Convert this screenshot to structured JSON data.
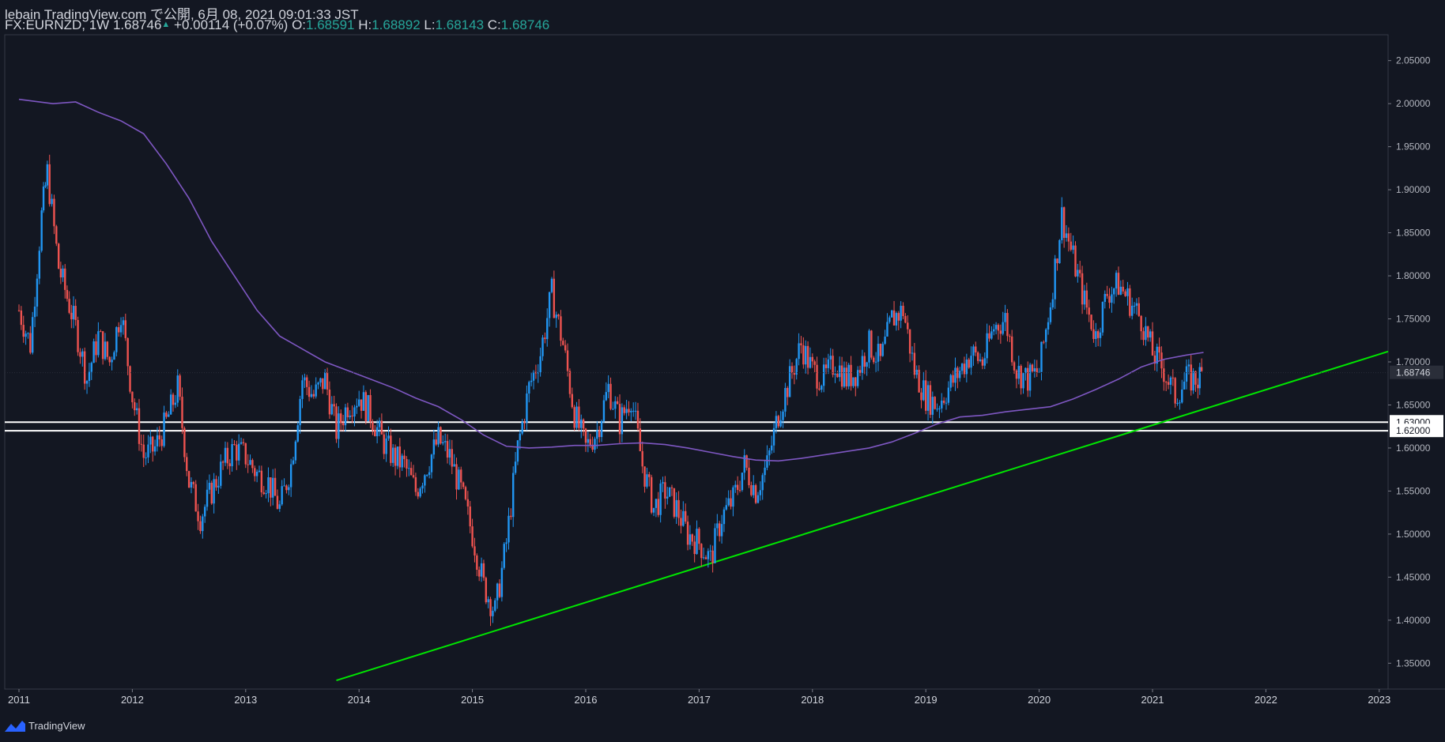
{
  "header": {
    "line1": "lebain TradingView.com で公開, 6月 08, 2021 09:01:33 JST",
    "symbol": "FX:EURNZD, 1W",
    "last": "1.68746",
    "change": "+0.00114 (+0.07%)",
    "open_label": "O:",
    "open": "1.68591",
    "high_label": "H:",
    "high": "1.68892",
    "low_label": "L:",
    "low": "1.68143",
    "close_label": "C:",
    "close": "1.68746"
  },
  "brand": "TradingView",
  "colors": {
    "background": "#131722",
    "up": "#2196f3",
    "down": "#ef5350",
    "ma": "#7e57c2",
    "trendline": "#00e600",
    "hline": "#ffffff",
    "text": "#d1d4dc"
  },
  "chart_data": {
    "type": "candlestick",
    "symbol": "FX:EURNZD",
    "interval": "1W",
    "ylim": [
      1.32,
      2.08
    ],
    "y_ticks": [
      "2.05000",
      "2.00000",
      "1.95000",
      "1.90000",
      "1.85000",
      "1.80000",
      "1.75000",
      "1.70000",
      "1.65000",
      "1.60000",
      "1.55000",
      "1.50000",
      "1.45000",
      "1.40000",
      "1.35000"
    ],
    "x_ticks": [
      "2011",
      "2012",
      "2013",
      "2014",
      "2015",
      "2016",
      "2017",
      "2018",
      "2019",
      "2020",
      "2021",
      "2022",
      "2023"
    ],
    "x_start_year": 2011,
    "price_series": [
      [
        2011.0,
        1.76
      ],
      [
        2011.1,
        1.72
      ],
      [
        2011.2,
        1.87
      ],
      [
        2011.25,
        1.92
      ],
      [
        2011.35,
        1.81
      ],
      [
        2011.5,
        1.74
      ],
      [
        2011.6,
        1.68
      ],
      [
        2011.7,
        1.73
      ],
      [
        2011.8,
        1.7
      ],
      [
        2011.9,
        1.76
      ],
      [
        2012.0,
        1.66
      ],
      [
        2012.1,
        1.59
      ],
      [
        2012.2,
        1.6
      ],
      [
        2012.3,
        1.63
      ],
      [
        2012.4,
        1.67
      ],
      [
        2012.5,
        1.56
      ],
      [
        2012.6,
        1.52
      ],
      [
        2012.7,
        1.55
      ],
      [
        2012.8,
        1.58
      ],
      [
        2012.9,
        1.6
      ],
      [
        2013.0,
        1.59
      ],
      [
        2013.1,
        1.57
      ],
      [
        2013.2,
        1.56
      ],
      [
        2013.3,
        1.53
      ],
      [
        2013.4,
        1.58
      ],
      [
        2013.5,
        1.68
      ],
      [
        2013.6,
        1.66
      ],
      [
        2013.7,
        1.68
      ],
      [
        2013.8,
        1.62
      ],
      [
        2013.9,
        1.65
      ],
      [
        2014.0,
        1.66
      ],
      [
        2014.1,
        1.64
      ],
      [
        2014.2,
        1.61
      ],
      [
        2014.3,
        1.59
      ],
      [
        2014.4,
        1.58
      ],
      [
        2014.5,
        1.55
      ],
      [
        2014.6,
        1.58
      ],
      [
        2014.7,
        1.61
      ],
      [
        2014.8,
        1.59
      ],
      [
        2014.9,
        1.55
      ],
      [
        2015.0,
        1.5
      ],
      [
        2015.1,
        1.44
      ],
      [
        2015.2,
        1.41
      ],
      [
        2015.3,
        1.49
      ],
      [
        2015.4,
        1.6
      ],
      [
        2015.5,
        1.67
      ],
      [
        2015.6,
        1.71
      ],
      [
        2015.7,
        1.78
      ],
      [
        2015.8,
        1.72
      ],
      [
        2015.9,
        1.64
      ],
      [
        2016.0,
        1.6
      ],
      [
        2016.1,
        1.62
      ],
      [
        2016.2,
        1.67
      ],
      [
        2016.3,
        1.63
      ],
      [
        2016.4,
        1.66
      ],
      [
        2016.5,
        1.58
      ],
      [
        2016.6,
        1.53
      ],
      [
        2016.7,
        1.55
      ],
      [
        2016.8,
        1.53
      ],
      [
        2016.9,
        1.5
      ],
      [
        2017.0,
        1.49
      ],
      [
        2017.1,
        1.47
      ],
      [
        2017.2,
        1.52
      ],
      [
        2017.3,
        1.54
      ],
      [
        2017.4,
        1.58
      ],
      [
        2017.5,
        1.55
      ],
      [
        2017.6,
        1.58
      ],
      [
        2017.7,
        1.64
      ],
      [
        2017.8,
        1.68
      ],
      [
        2017.9,
        1.72
      ],
      [
        2018.0,
        1.69
      ],
      [
        2018.1,
        1.68
      ],
      [
        2018.2,
        1.7
      ],
      [
        2018.3,
        1.68
      ],
      [
        2018.4,
        1.69
      ],
      [
        2018.5,
        1.72
      ],
      [
        2018.6,
        1.7
      ],
      [
        2018.7,
        1.75
      ],
      [
        2018.8,
        1.76
      ],
      [
        2018.9,
        1.69
      ],
      [
        2019.0,
        1.66
      ],
      [
        2019.1,
        1.65
      ],
      [
        2019.2,
        1.67
      ],
      [
        2019.3,
        1.69
      ],
      [
        2019.4,
        1.71
      ],
      [
        2019.5,
        1.7
      ],
      [
        2019.6,
        1.74
      ],
      [
        2019.7,
        1.75
      ],
      [
        2019.8,
        1.69
      ],
      [
        2019.9,
        1.68
      ],
      [
        2020.0,
        1.69
      ],
      [
        2020.1,
        1.77
      ],
      [
        2020.2,
        1.87
      ],
      [
        2020.3,
        1.82
      ],
      [
        2020.4,
        1.77
      ],
      [
        2020.5,
        1.73
      ],
      [
        2020.6,
        1.78
      ],
      [
        2020.7,
        1.79
      ],
      [
        2020.8,
        1.77
      ],
      [
        2020.9,
        1.75
      ],
      [
        2021.0,
        1.71
      ],
      [
        2021.1,
        1.69
      ],
      [
        2021.2,
        1.66
      ],
      [
        2021.3,
        1.68
      ],
      [
        2021.4,
        1.68
      ],
      [
        2021.45,
        1.6875
      ]
    ],
    "moving_average": [
      [
        2011.0,
        2.005
      ],
      [
        2011.3,
        2.0
      ],
      [
        2011.5,
        2.002
      ],
      [
        2011.7,
        1.99
      ],
      [
        2011.9,
        1.98
      ],
      [
        2012.1,
        1.965
      ],
      [
        2012.3,
        1.93
      ],
      [
        2012.5,
        1.89
      ],
      [
        2012.7,
        1.84
      ],
      [
        2012.9,
        1.8
      ],
      [
        2013.1,
        1.76
      ],
      [
        2013.3,
        1.73
      ],
      [
        2013.5,
        1.715
      ],
      [
        2013.7,
        1.7
      ],
      [
        2013.9,
        1.69
      ],
      [
        2014.1,
        1.68
      ],
      [
        2014.3,
        1.67
      ],
      [
        2014.5,
        1.658
      ],
      [
        2014.7,
        1.648
      ],
      [
        2014.9,
        1.633
      ],
      [
        2015.1,
        1.615
      ],
      [
        2015.3,
        1.602
      ],
      [
        2015.5,
        1.6
      ],
      [
        2015.7,
        1.601
      ],
      [
        2015.9,
        1.603
      ],
      [
        2016.1,
        1.603
      ],
      [
        2016.3,
        1.605
      ],
      [
        2016.5,
        1.606
      ],
      [
        2016.7,
        1.604
      ],
      [
        2016.9,
        1.6
      ],
      [
        2017.1,
        1.595
      ],
      [
        2017.3,
        1.59
      ],
      [
        2017.5,
        1.586
      ],
      [
        2017.7,
        1.585
      ],
      [
        2017.9,
        1.588
      ],
      [
        2018.1,
        1.592
      ],
      [
        2018.3,
        1.596
      ],
      [
        2018.5,
        1.6
      ],
      [
        2018.7,
        1.607
      ],
      [
        2018.9,
        1.617
      ],
      [
        2019.1,
        1.628
      ],
      [
        2019.3,
        1.636
      ],
      [
        2019.5,
        1.638
      ],
      [
        2019.7,
        1.642
      ],
      [
        2019.9,
        1.645
      ],
      [
        2020.1,
        1.648
      ],
      [
        2020.3,
        1.657
      ],
      [
        2020.5,
        1.668
      ],
      [
        2020.7,
        1.68
      ],
      [
        2020.9,
        1.694
      ],
      [
        2021.1,
        1.703
      ],
      [
        2021.3,
        1.708
      ],
      [
        2021.45,
        1.711
      ]
    ],
    "trendline": {
      "from": [
        2013.8,
        1.33
      ],
      "to": [
        2023.1,
        1.713
      ]
    },
    "horizontal_levels": [
      "1.63000",
      "1.62000"
    ],
    "last_price_label": "1.68746"
  }
}
